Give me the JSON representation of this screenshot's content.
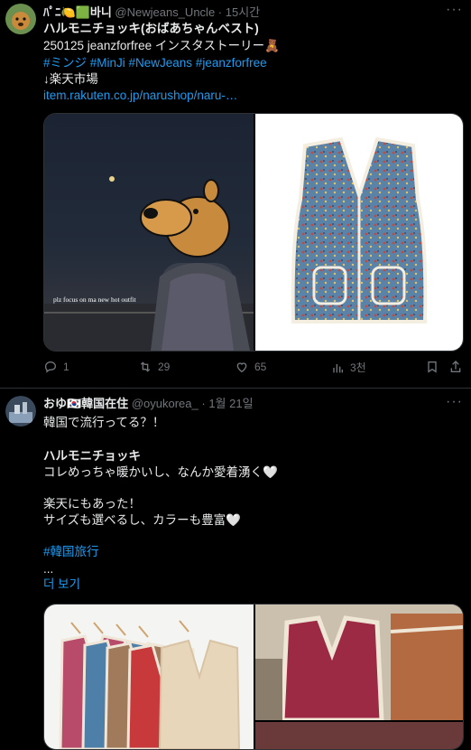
{
  "tweets": [
    {
      "display_name": "ﾊﾟﾆ🍋🟩바니",
      "handle": "@Newjeans_Uncle",
      "sep": "·",
      "time": "15시간",
      "lines": [
        "ハルモニチョッキ(おばあちゃんベスト)",
        "250125 jeanzforfree インスタストーリー🧸",
        "#ミンジ #MinJi #NewJeans #jeanzforfree",
        "↓楽天市場",
        "item.rakuten.co.jp/narushop/naru-…"
      ],
      "image_caption": "plz focus on ma new hot outfit",
      "counts": {
        "reply": "1",
        "retweet": "29",
        "like": "65",
        "views": "3천"
      }
    },
    {
      "display_name": "おゆ🇰🇷韓国在住",
      "handle": "@oyukorea_",
      "sep": "·",
      "time": "1월 21일",
      "lines": [
        "韓国で流行ってる？！",
        "",
        "ハルモニチョッキ",
        "コレめっちゃ暖かいし、なんか愛着湧く🤍",
        "",
        "楽天にもあった！",
        "サイズも選べるし、カラーも豊富🤍",
        "",
        "#韓国旅行",
        "...",
        "더 보기"
      ]
    }
  ],
  "more_icon_glyph": "···",
  "colors": {
    "link": "#1d9bf0",
    "muted": "#71767b",
    "text": "#e7e9ea",
    "bg": "#000000"
  }
}
